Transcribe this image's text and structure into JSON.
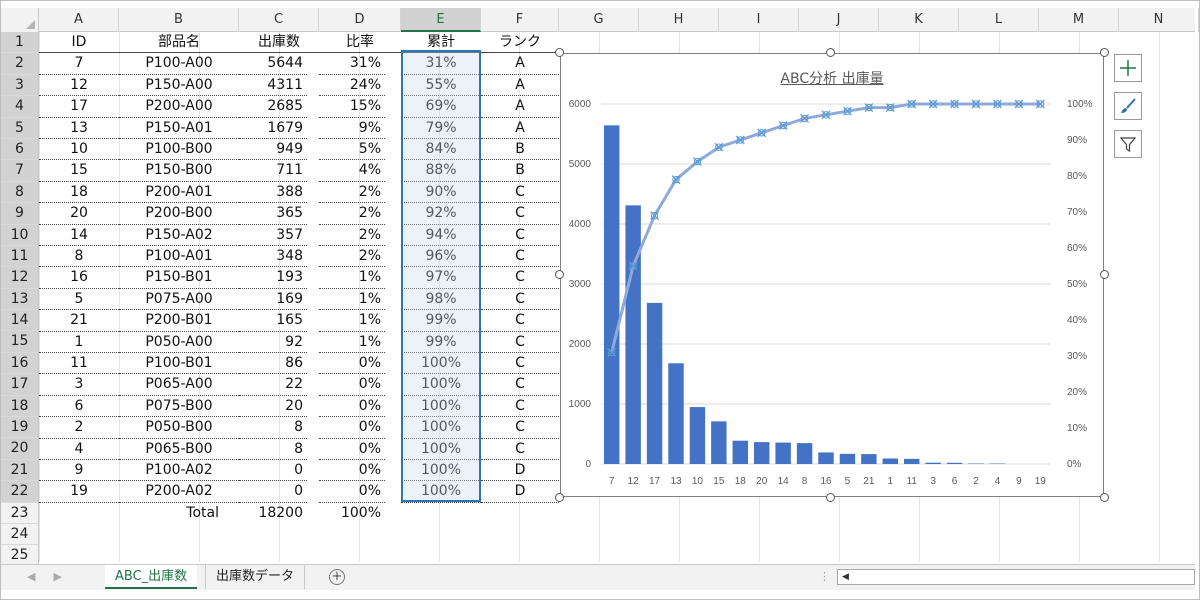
{
  "columns": [
    "A",
    "B",
    "C",
    "D",
    "E",
    "F",
    "G",
    "H",
    "I",
    "J",
    "K",
    "L",
    "M",
    "N"
  ],
  "row_numbers": [
    "1",
    "2",
    "3",
    "4",
    "5",
    "6",
    "7",
    "8",
    "9",
    "10",
    "11",
    "12",
    "13",
    "14",
    "15",
    "16",
    "17",
    "18",
    "19",
    "20",
    "21",
    "22",
    "23",
    "24",
    "25"
  ],
  "headers": {
    "id": "ID",
    "part": "部品名",
    "qty": "出庫数",
    "ratio": "比率",
    "cum": "累計",
    "rank": "ランク"
  },
  "rows": [
    {
      "id": "7",
      "part": "P100-A00",
      "qty": "5644",
      "ratio": "31%",
      "cum": "31%",
      "rank": "A"
    },
    {
      "id": "12",
      "part": "P150-A00",
      "qty": "4311",
      "ratio": "24%",
      "cum": "55%",
      "rank": "A"
    },
    {
      "id": "17",
      "part": "P200-A00",
      "qty": "2685",
      "ratio": "15%",
      "cum": "69%",
      "rank": "A"
    },
    {
      "id": "13",
      "part": "P150-A01",
      "qty": "1679",
      "ratio": "9%",
      "cum": "79%",
      "rank": "A"
    },
    {
      "id": "10",
      "part": "P100-B00",
      "qty": "949",
      "ratio": "5%",
      "cum": "84%",
      "rank": "B"
    },
    {
      "id": "15",
      "part": "P150-B00",
      "qty": "711",
      "ratio": "4%",
      "cum": "88%",
      "rank": "B"
    },
    {
      "id": "18",
      "part": "P200-A01",
      "qty": "388",
      "ratio": "2%",
      "cum": "90%",
      "rank": "C"
    },
    {
      "id": "20",
      "part": "P200-B00",
      "qty": "365",
      "ratio": "2%",
      "cum": "92%",
      "rank": "C"
    },
    {
      "id": "14",
      "part": "P150-A02",
      "qty": "357",
      "ratio": "2%",
      "cum": "94%",
      "rank": "C"
    },
    {
      "id": "8",
      "part": "P100-A01",
      "qty": "348",
      "ratio": "2%",
      "cum": "96%",
      "rank": "C"
    },
    {
      "id": "16",
      "part": "P150-B01",
      "qty": "193",
      "ratio": "1%",
      "cum": "97%",
      "rank": "C"
    },
    {
      "id": "5",
      "part": "P075-A00",
      "qty": "169",
      "ratio": "1%",
      "cum": "98%",
      "rank": "C"
    },
    {
      "id": "21",
      "part": "P200-B01",
      "qty": "165",
      "ratio": "1%",
      "cum": "99%",
      "rank": "C"
    },
    {
      "id": "1",
      "part": "P050-A00",
      "qty": "92",
      "ratio": "1%",
      "cum": "99%",
      "rank": "C"
    },
    {
      "id": "11",
      "part": "P100-B01",
      "qty": "86",
      "ratio": "0%",
      "cum": "100%",
      "rank": "C"
    },
    {
      "id": "3",
      "part": "P065-A00",
      "qty": "22",
      "ratio": "0%",
      "cum": "100%",
      "rank": "C"
    },
    {
      "id": "6",
      "part": "P075-B00",
      "qty": "20",
      "ratio": "0%",
      "cum": "100%",
      "rank": "C"
    },
    {
      "id": "2",
      "part": "P050-B00",
      "qty": "8",
      "ratio": "0%",
      "cum": "100%",
      "rank": "C"
    },
    {
      "id": "4",
      "part": "P065-B00",
      "qty": "8",
      "ratio": "0%",
      "cum": "100%",
      "rank": "C"
    },
    {
      "id": "9",
      "part": "P100-A02",
      "qty": "0",
      "ratio": "0%",
      "cum": "100%",
      "rank": "D"
    },
    {
      "id": "19",
      "part": "P200-A02",
      "qty": "0",
      "ratio": "0%",
      "cum": "100%",
      "rank": "D"
    }
  ],
  "total": {
    "label": "Total",
    "qty": "18200",
    "ratio": "100%"
  },
  "selected_column": "E",
  "colors": {
    "accent": "#217346",
    "bar": "#4472c4",
    "line": "#8eaadb",
    "selection": "#2f75b5"
  },
  "sheets": {
    "active": "ABC_出庫数",
    "other": "出庫数データ"
  },
  "chart_data": {
    "type": "bar",
    "title": "ABC分析 出庫量",
    "categories": [
      "7",
      "12",
      "17",
      "13",
      "10",
      "15",
      "18",
      "20",
      "14",
      "8",
      "16",
      "5",
      "21",
      "1",
      "11",
      "3",
      "6",
      "2",
      "4",
      "9",
      "19"
    ],
    "series": [
      {
        "type": "bar",
        "axis": "left",
        "values": [
          5644,
          4311,
          2685,
          1679,
          949,
          711,
          388,
          365,
          357,
          348,
          193,
          169,
          165,
          92,
          86,
          22,
          20,
          8,
          8,
          0,
          0
        ]
      },
      {
        "type": "line",
        "axis": "right",
        "values": [
          0.31,
          0.55,
          0.69,
          0.79,
          0.84,
          0.88,
          0.9,
          0.92,
          0.94,
          0.96,
          0.97,
          0.98,
          0.99,
          0.99,
          1.0,
          1.0,
          1.0,
          1.0,
          1.0,
          1.0,
          1.0
        ]
      }
    ],
    "ylim": [
      0,
      6000
    ],
    "y_ticks": [
      "0",
      "1000",
      "2000",
      "3000",
      "4000",
      "5000",
      "6000"
    ],
    "y2lim": [
      0,
      1
    ],
    "y2_ticks": [
      "0%",
      "10%",
      "20%",
      "30%",
      "40%",
      "50%",
      "60%",
      "70%",
      "80%",
      "90%",
      "100%"
    ],
    "grid": true,
    "legend": "none"
  },
  "icons": {
    "add_element": "plus-icon",
    "styles": "brush-icon",
    "filter": "filter-icon"
  }
}
